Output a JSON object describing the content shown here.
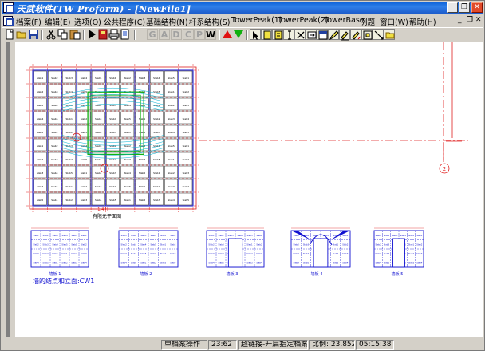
{
  "window": {
    "title": "天武软件(TW Proform) - [NewFile1]",
    "buttons": {
      "minimize": "_",
      "restore": "❐",
      "close": "✕"
    }
  },
  "menu": {
    "items": [
      {
        "label": "档案(F)"
      },
      {
        "label": "编辑(E)"
      },
      {
        "label": "选项(O)"
      },
      {
        "label": "公共程序(C)"
      },
      {
        "label": "基础结构(N)"
      },
      {
        "label": "杆系结构(S)"
      },
      {
        "label": "TowerPeak(1)"
      },
      {
        "label": "TowerPeak(2)"
      },
      {
        "label": "TowerBase"
      },
      {
        "label": "例题"
      },
      {
        "label": "窗口(W)"
      },
      {
        "label": "帮助(H)"
      }
    ],
    "mdi_buttons": {
      "minimize": "_",
      "restore": "❐",
      "close": "✕"
    }
  },
  "toolbar": {
    "letters": [
      "G",
      "A",
      "D",
      "C",
      "P",
      "W"
    ],
    "icons": [
      "new-file-icon",
      "open-folder-icon",
      "save-icon",
      "cut-icon",
      "copy-icon",
      "paste-icon",
      "run-icon",
      "book-icon",
      "print-icon",
      "preview-icon",
      "arrow-up-icon",
      "arrow-down-icon"
    ]
  },
  "drawing": {
    "plan_title": "有限元平面图",
    "plan_dim_label": "1/4 H",
    "elevations": [
      "墙板 1",
      "墙板 2",
      "墙板 3",
      "墙板 4",
      "墙板 5"
    ],
    "wall_caption": "墙的结点和立面:CW1",
    "axis_marker": "2",
    "cell_labels": [
      "Slab1",
      "Slab2",
      "Slab3",
      "Slab4",
      "Slab5"
    ],
    "colors": {
      "grid_red": "#e02020",
      "slab_blue": "#1010d0",
      "mesh_green": "#10b010",
      "cyan": "#00b0d0"
    }
  },
  "status": {
    "mode": "单档案操作",
    "position": "23:62",
    "hyperlink": "超链接-开启指定档案",
    "scale": "比例: 23.852",
    "time": "05:15:38"
  }
}
